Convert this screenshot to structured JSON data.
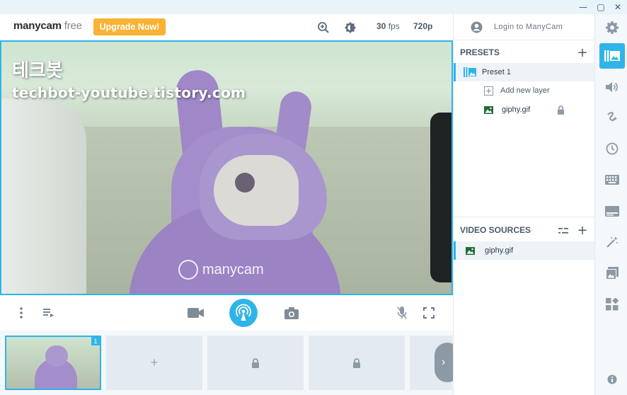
{
  "header": {
    "logo_main": "manycam",
    "logo_suffix": "free",
    "upgrade_label": "Upgrade Now!",
    "fps_value": "30",
    "fps_unit": "fps",
    "resolution": "720p",
    "zoom_icon": "zoom-in-icon",
    "brightness_icon": "brightness-icon"
  },
  "window_controls": {
    "minimize": "—",
    "maximize": "▢",
    "close": "✕"
  },
  "video": {
    "watermark_korean": "테크봇",
    "watermark_url": "techbot-youtube.tistory.com",
    "overlay_brand": "manycam"
  },
  "controls": {
    "left": [
      "more-vertical-icon",
      "playlist-icon"
    ],
    "center": [
      "camera-icon",
      "broadcast-icon",
      "snapshot-icon"
    ],
    "right": [
      "mic-icon",
      "fullscreen-icon"
    ]
  },
  "thumbnails": [
    {
      "type": "active",
      "badge": "1"
    },
    {
      "type": "add",
      "symbol": "+"
    },
    {
      "type": "locked"
    },
    {
      "type": "locked"
    }
  ],
  "right_panel": {
    "login_label": "Login to ManyCam",
    "presets_title": "PRESETS",
    "preset_name": "Preset 1",
    "add_layer_label": "Add new layer",
    "layer_name": "giphy.gif",
    "video_sources_title": "VIDEO SOURCES",
    "source_name": "giphy.gif"
  },
  "rail": {
    "items": [
      "presets-icon",
      "audio-icon",
      "drawing-icon",
      "history-icon",
      "keyboard-icon",
      "lower-thirds-icon",
      "effects-icon",
      "images-icon",
      "widgets-icon",
      "info-icon"
    ]
  },
  "colors": {
    "accent": "#2fb4ea",
    "upgrade": "#f9b233"
  }
}
